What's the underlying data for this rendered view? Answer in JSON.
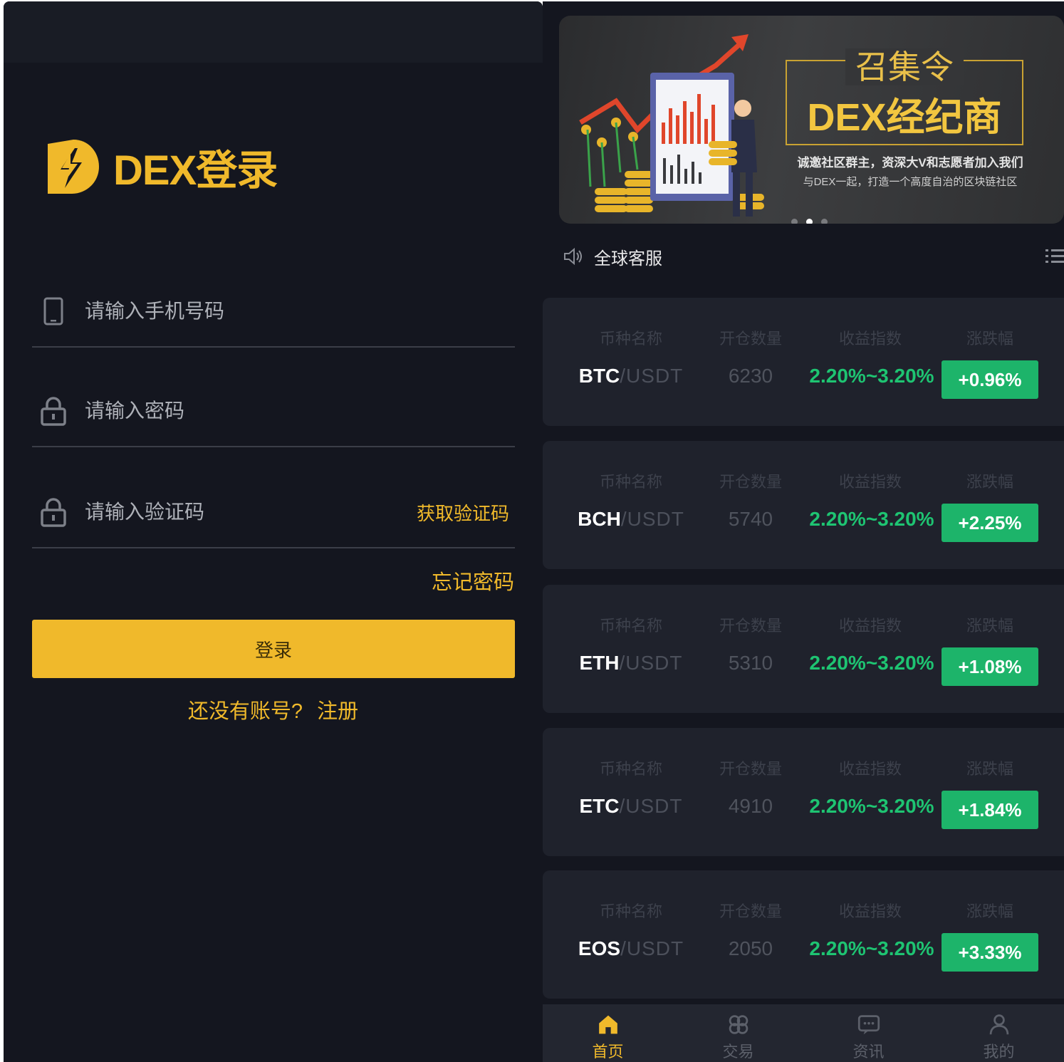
{
  "login": {
    "title": "DEX登录",
    "phone_placeholder": "请输入手机号码",
    "password_placeholder": "请输入密码",
    "code_placeholder": "请输入验证码",
    "get_code": "获取验证码",
    "forgot": "忘记密码",
    "login_button": "登录",
    "register_prompt": "还没有账号?",
    "register_link": "注册",
    "accent_color": "#f0b92b"
  },
  "banner": {
    "title1": "召集令",
    "title2": "DEX经纪商",
    "subtitle1": "诚邀社区群主，资深大V和志愿者加入我们",
    "subtitle2": "与DEX一起，打造一个高度自治的区块链社区",
    "active_dot": 1
  },
  "notice": {
    "label": "全球客服"
  },
  "columns": {
    "name": "币种名称",
    "qty": "开仓数量",
    "yield": "收益指数",
    "change": "涨跌幅"
  },
  "markets": [
    {
      "base": "BTC",
      "quote": "/USDT",
      "qty": "6230",
      "yield": "2.20%~3.20%",
      "change": "+0.96%"
    },
    {
      "base": "BCH",
      "quote": "/USDT",
      "qty": "5740",
      "yield": "2.20%~3.20%",
      "change": "+2.25%"
    },
    {
      "base": "ETH",
      "quote": "/USDT",
      "qty": "5310",
      "yield": "2.20%~3.20%",
      "change": "+1.08%"
    },
    {
      "base": "ETC",
      "quote": "/USDT",
      "qty": "4910",
      "yield": "2.20%~3.20%",
      "change": "+1.84%"
    },
    {
      "base": "EOS",
      "quote": "/USDT",
      "qty": "2050",
      "yield": "2.20%~3.20%",
      "change": "+3.33%"
    }
  ],
  "tabs": [
    {
      "label": "首页",
      "icon": "home-icon",
      "active": true
    },
    {
      "label": "交易",
      "icon": "trade-icon",
      "active": false
    },
    {
      "label": "资讯",
      "icon": "news-icon",
      "active": false
    },
    {
      "label": "我的",
      "icon": "user-icon",
      "active": false
    }
  ],
  "colors": {
    "background": "#14161f",
    "card": "#1f222c",
    "up_green": "#1db46a",
    "gold": "#f0b92b"
  }
}
